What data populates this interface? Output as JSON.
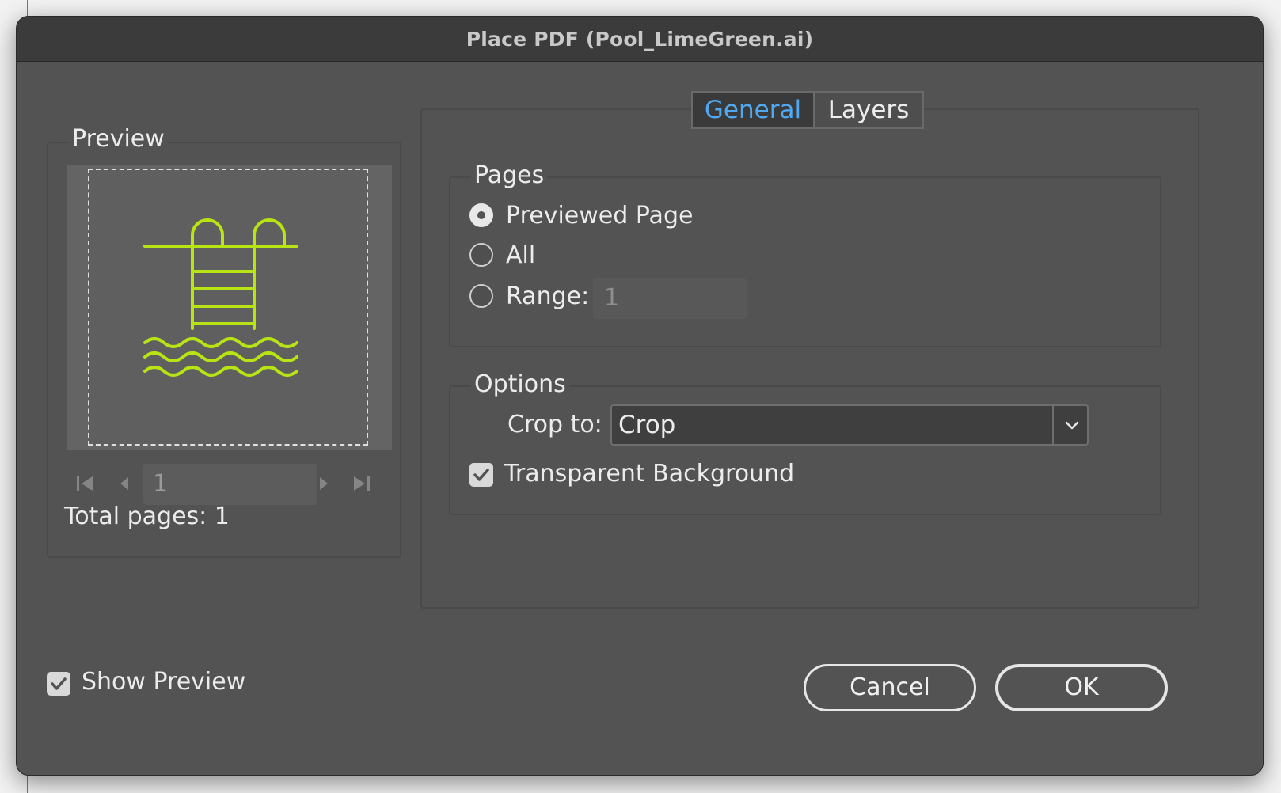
{
  "window": {
    "title": "Place PDF (Pool_LimeGreen.ai)"
  },
  "preview": {
    "group_label": "Preview",
    "page_number": "1",
    "total_pages_text": "Total pages: 1",
    "artwork_color": "#b8e414"
  },
  "tabs": [
    {
      "label": "General",
      "active": true
    },
    {
      "label": "Layers",
      "active": false
    }
  ],
  "pages": {
    "group_label": "Pages",
    "options": [
      {
        "label": "Previewed Page",
        "selected": true
      },
      {
        "label": "All",
        "selected": false
      },
      {
        "label": "Range:",
        "selected": false
      }
    ],
    "range_value": "1"
  },
  "options": {
    "group_label": "Options",
    "crop_label": "Crop to:",
    "crop_value": "Crop",
    "transparent_background": {
      "label": "Transparent Background",
      "checked": true
    }
  },
  "show_preview": {
    "label": "Show Preview",
    "checked": true
  },
  "buttons": {
    "cancel": "Cancel",
    "ok": "OK"
  },
  "colors": {
    "active_tab": "#4fa8f0",
    "dialog_bg": "#535353"
  }
}
